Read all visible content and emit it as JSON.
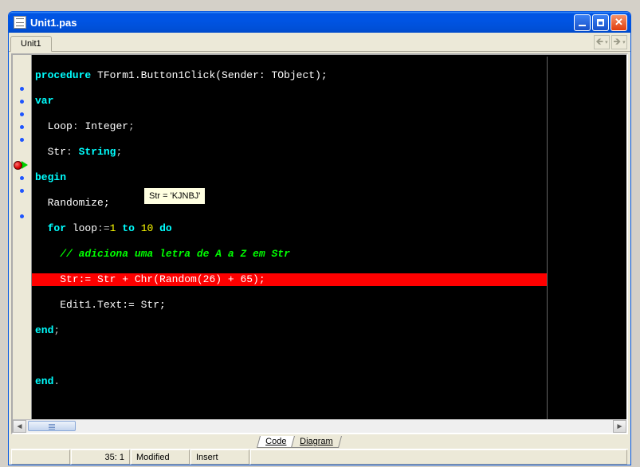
{
  "window": {
    "title": "Unit1.pas"
  },
  "tabs": [
    "Unit1"
  ],
  "bottom_tabs": [
    "Code",
    "Diagram"
  ],
  "status": {
    "position": "35: 1",
    "modified": "Modified",
    "mode": "Insert"
  },
  "tooltip": "Str = 'KJNBJ'",
  "code": {
    "l1": {
      "a": "procedure",
      "b": "TForm1.Button1Click(Sender: TObject);"
    },
    "l2": {
      "a": "var"
    },
    "l3": {
      "a": "Loop",
      "b": ": ",
      "c": "Integer",
      "d": ";"
    },
    "l4": {
      "a": "Str",
      "b": ": ",
      "c": "String",
      "d": ";"
    },
    "l5": {
      "a": "begin"
    },
    "l6": {
      "a": "Randomize;"
    },
    "l7": {
      "a": "for",
      "b": "loop",
      "c": ":=",
      "d": "1",
      "e": "to",
      "f": "10",
      "g": "do"
    },
    "l8": {
      "a": "// adiciona uma letra de A a Z em Str"
    },
    "l9": {
      "a": "Str:= Str + Chr(Random(26) + 65);"
    },
    "l10": {
      "a": "Edit1.Text:= Str;"
    },
    "l11": {
      "a": "end",
      "b": ";"
    },
    "l13": {
      "a": "end",
      "b": "."
    }
  }
}
